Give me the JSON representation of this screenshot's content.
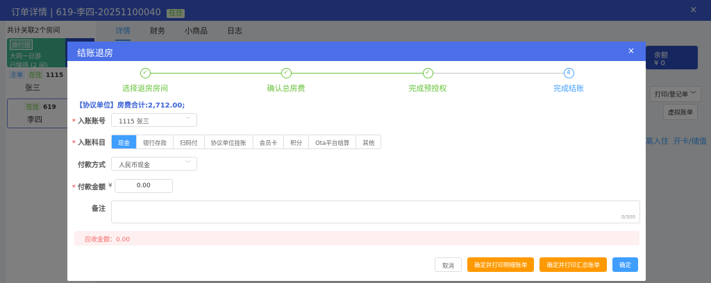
{
  "background": {
    "title": "订单详情 | 619-李四-20251100040",
    "status": "在住",
    "close": "×",
    "room_count": "共计关联2个房间",
    "group": {
      "tag": "旅行团",
      "name": "大同一日游",
      "received": "已接待 (2 间)"
    },
    "rooms": [
      {
        "tags": [
          "主单",
          "在住"
        ],
        "number": "1115",
        "guest": "张三"
      },
      {
        "tags": [
          "在住"
        ],
        "number": "619",
        "guest": "李四"
      }
    ],
    "tabs": [
      "详情",
      "财务",
      "小商品",
      "日志"
    ],
    "balance": {
      "label": "余额",
      "value": "¥ 0"
    },
    "print_button": "打印/登记单 ﹀",
    "virtual_bill": "虚拟账单",
    "links": [
      "离入住",
      "开卡/储值"
    ]
  },
  "modal": {
    "title": "结账退房",
    "close": "×",
    "steps": [
      {
        "label": "选择退房房间",
        "state": "done",
        "mark": "✓"
      },
      {
        "label": "确认总房费",
        "state": "done",
        "mark": "✓"
      },
      {
        "label": "完成预授权",
        "state": "done",
        "mark": "✓"
      },
      {
        "label": "完成结账",
        "state": "current",
        "mark": "4"
      }
    ],
    "summary": "【协议单位】房费合计:2,712.00;",
    "account": {
      "label": "入账账号",
      "value": "1115 张三"
    },
    "subject": {
      "label": "入账科目",
      "options": [
        "现金",
        "银行存款",
        "扫码付",
        "协议单位挂账",
        "会员卡",
        "积分",
        "Ota平台结算",
        "其他"
      ],
      "selected": "现金"
    },
    "pay_method": {
      "label": "付款方式",
      "value": "人民币现金"
    },
    "amount": {
      "label": "付款金额",
      "currency": "¥",
      "value": "0.00"
    },
    "remark": {
      "label": "备注",
      "counter": "0/300"
    },
    "receivable": "应收金额：0.00",
    "buttons": {
      "cancel": "取消",
      "print_detail": "确定并打印明细账单",
      "print_summary": "确定并打印汇总账单",
      "confirm": "确定"
    }
  },
  "colors": {
    "primary": "#409eff",
    "header": "#4a6fe8",
    "success": "#67c23a",
    "warning": "#ff9900",
    "danger": "#f56c6c"
  }
}
